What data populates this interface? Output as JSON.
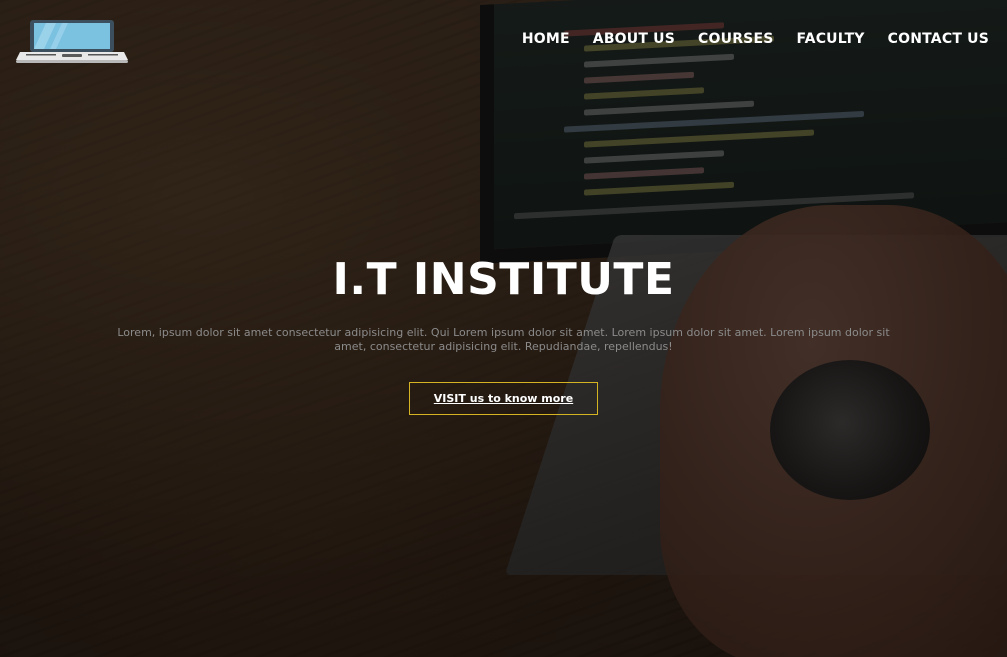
{
  "nav": {
    "items": [
      {
        "label": "HOME"
      },
      {
        "label": "ABOUT US"
      },
      {
        "label": "COURSES"
      },
      {
        "label": "FACULTY"
      },
      {
        "label": "CONTACT US"
      }
    ]
  },
  "logo": {
    "icon": "laptop-icon"
  },
  "hero": {
    "title": "I.T INSTITUTE",
    "description": "Lorem, ipsum dolor sit amet consectetur adipisicing elit. Qui Lorem ipsum dolor sit amet. Lorem ipsum dolor sit amet. Lorem ipsum dolor sit amet, consectetur adipisicing elit. Repudiandae, repellendus!",
    "cta_label": "VISIT us to know more"
  },
  "colors": {
    "accent_border": "#d4b422",
    "text": "#ffffff",
    "muted_text": "#8b8b8b"
  }
}
